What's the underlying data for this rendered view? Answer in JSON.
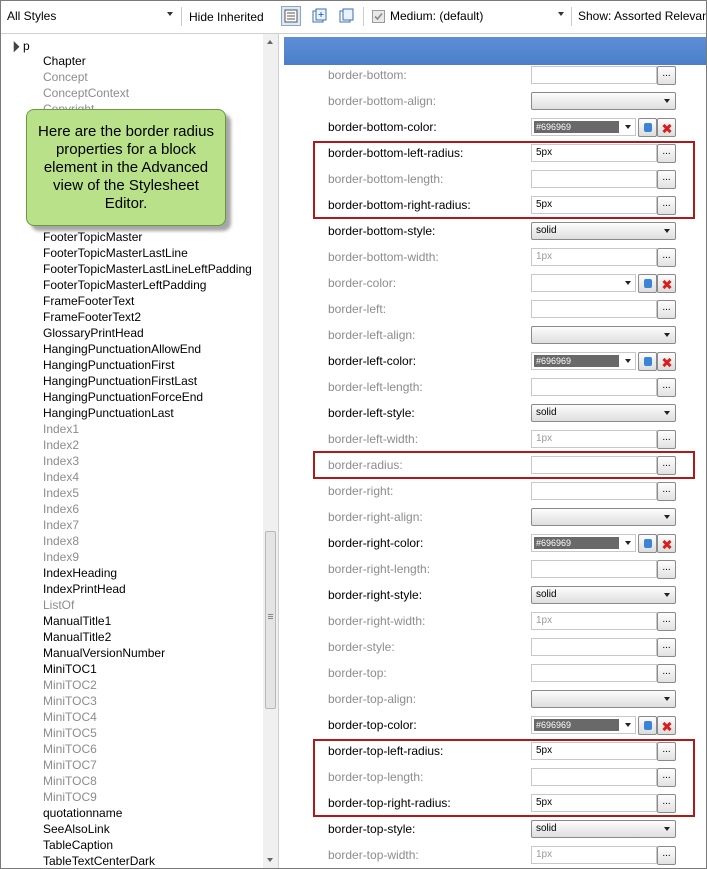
{
  "toolbar": {
    "styles_filter": "All Styles",
    "hide_inherited": "Hide Inherited",
    "medium": "Medium: (default)",
    "show": "Show: Assorted Relevant"
  },
  "tree": {
    "root": "p",
    "items": [
      {
        "label": "Chapter",
        "dim": false
      },
      {
        "label": "Concept",
        "dim": true
      },
      {
        "label": "ConceptContext",
        "dim": true
      },
      {
        "label": "Copyright",
        "dim": true
      },
      {
        "label": "FooterTopicMaster",
        "dim": false
      },
      {
        "label": "FooterTopicMasterLastLine",
        "dim": false
      },
      {
        "label": "FooterTopicMasterLastLineLeftPadding",
        "dim": false
      },
      {
        "label": "FooterTopicMasterLeftPadding",
        "dim": false
      },
      {
        "label": "FrameFooterText",
        "dim": false
      },
      {
        "label": "FrameFooterText2",
        "dim": false
      },
      {
        "label": "GlossaryPrintHead",
        "dim": false
      },
      {
        "label": "HangingPunctuationAllowEnd",
        "dim": false
      },
      {
        "label": "HangingPunctuationFirst",
        "dim": false
      },
      {
        "label": "HangingPunctuationFirstLast",
        "dim": false
      },
      {
        "label": "HangingPunctuationForceEnd",
        "dim": false
      },
      {
        "label": "HangingPunctuationLast",
        "dim": false
      },
      {
        "label": "Index1",
        "dim": true
      },
      {
        "label": "Index2",
        "dim": true
      },
      {
        "label": "Index3",
        "dim": true
      },
      {
        "label": "Index4",
        "dim": true
      },
      {
        "label": "Index5",
        "dim": true
      },
      {
        "label": "Index6",
        "dim": true
      },
      {
        "label": "Index7",
        "dim": true
      },
      {
        "label": "Index8",
        "dim": true
      },
      {
        "label": "Index9",
        "dim": true
      },
      {
        "label": "IndexHeading",
        "dim": false
      },
      {
        "label": "IndexPrintHead",
        "dim": false
      },
      {
        "label": "ListOf",
        "dim": true
      },
      {
        "label": "ManualTitle1",
        "dim": false
      },
      {
        "label": "ManualTitle2",
        "dim": false
      },
      {
        "label": "ManualVersionNumber",
        "dim": false
      },
      {
        "label": "MiniTOC1",
        "dim": false
      },
      {
        "label": "MiniTOC2",
        "dim": true
      },
      {
        "label": "MiniTOC3",
        "dim": true
      },
      {
        "label": "MiniTOC4",
        "dim": true
      },
      {
        "label": "MiniTOC5",
        "dim": true
      },
      {
        "label": "MiniTOC6",
        "dim": true
      },
      {
        "label": "MiniTOC7",
        "dim": true
      },
      {
        "label": "MiniTOC8",
        "dim": true
      },
      {
        "label": "MiniTOC9",
        "dim": true
      },
      {
        "label": "quotationname",
        "dim": false
      },
      {
        "label": "SeeAlsoLink",
        "dim": false
      },
      {
        "label": "TableCaption",
        "dim": false
      },
      {
        "label": "TableTextCenterDark",
        "dim": false
      }
    ]
  },
  "callout": {
    "text": "Here are the border radius properties for a block element in the Advanced view of the Stylesheet Editor."
  },
  "properties": [
    {
      "name": "border-bottom:",
      "dim": true,
      "kind": "text",
      "value": ""
    },
    {
      "name": "border-bottom-align:",
      "dim": true,
      "kind": "select",
      "value": ""
    },
    {
      "name": "border-bottom-color:",
      "dim": false,
      "kind": "color",
      "value": "#696969"
    },
    {
      "name": "border-bottom-left-radius:",
      "dim": false,
      "kind": "text",
      "value": "5px"
    },
    {
      "name": "border-bottom-length:",
      "dim": true,
      "kind": "text",
      "value": ""
    },
    {
      "name": "border-bottom-right-radius:",
      "dim": false,
      "kind": "text",
      "value": "5px"
    },
    {
      "name": "border-bottom-style:",
      "dim": false,
      "kind": "select",
      "value": "solid"
    },
    {
      "name": "border-bottom-width:",
      "dim": true,
      "kind": "text",
      "value": "1px",
      "valdim": true
    },
    {
      "name": "border-color:",
      "dim": true,
      "kind": "color",
      "value": ""
    },
    {
      "name": "border-left:",
      "dim": true,
      "kind": "text",
      "value": ""
    },
    {
      "name": "border-left-align:",
      "dim": true,
      "kind": "select",
      "value": ""
    },
    {
      "name": "border-left-color:",
      "dim": false,
      "kind": "color",
      "value": "#696969"
    },
    {
      "name": "border-left-length:",
      "dim": true,
      "kind": "text",
      "value": ""
    },
    {
      "name": "border-left-style:",
      "dim": false,
      "kind": "select",
      "value": "solid"
    },
    {
      "name": "border-left-width:",
      "dim": true,
      "kind": "text",
      "value": "1px",
      "valdim": true
    },
    {
      "name": "border-radius:",
      "dim": true,
      "kind": "text",
      "value": ""
    },
    {
      "name": "border-right:",
      "dim": true,
      "kind": "text",
      "value": ""
    },
    {
      "name": "border-right-align:",
      "dim": true,
      "kind": "select",
      "value": ""
    },
    {
      "name": "border-right-color:",
      "dim": false,
      "kind": "color",
      "value": "#696969"
    },
    {
      "name": "border-right-length:",
      "dim": true,
      "kind": "text",
      "value": ""
    },
    {
      "name": "border-right-style:",
      "dim": false,
      "kind": "select",
      "value": "solid"
    },
    {
      "name": "border-right-width:",
      "dim": true,
      "kind": "text",
      "value": "1px",
      "valdim": true
    },
    {
      "name": "border-style:",
      "dim": true,
      "kind": "text",
      "value": ""
    },
    {
      "name": "border-top:",
      "dim": true,
      "kind": "text",
      "value": ""
    },
    {
      "name": "border-top-align:",
      "dim": true,
      "kind": "select",
      "value": ""
    },
    {
      "name": "border-top-color:",
      "dim": false,
      "kind": "color",
      "value": "#696969"
    },
    {
      "name": "border-top-left-radius:",
      "dim": false,
      "kind": "text",
      "value": "5px"
    },
    {
      "name": "border-top-length:",
      "dim": true,
      "kind": "text",
      "value": ""
    },
    {
      "name": "border-top-right-radius:",
      "dim": false,
      "kind": "text",
      "value": "5px"
    },
    {
      "name": "border-top-style:",
      "dim": false,
      "kind": "select",
      "value": "solid"
    },
    {
      "name": "border-top-width:",
      "dim": true,
      "kind": "text",
      "value": "1px",
      "valdim": true
    }
  ],
  "colors": {
    "header_blue": "#4a7fc9",
    "highlight_red": "#b0191c",
    "callout_green": "#b8e18a",
    "swatch": "#696969"
  }
}
